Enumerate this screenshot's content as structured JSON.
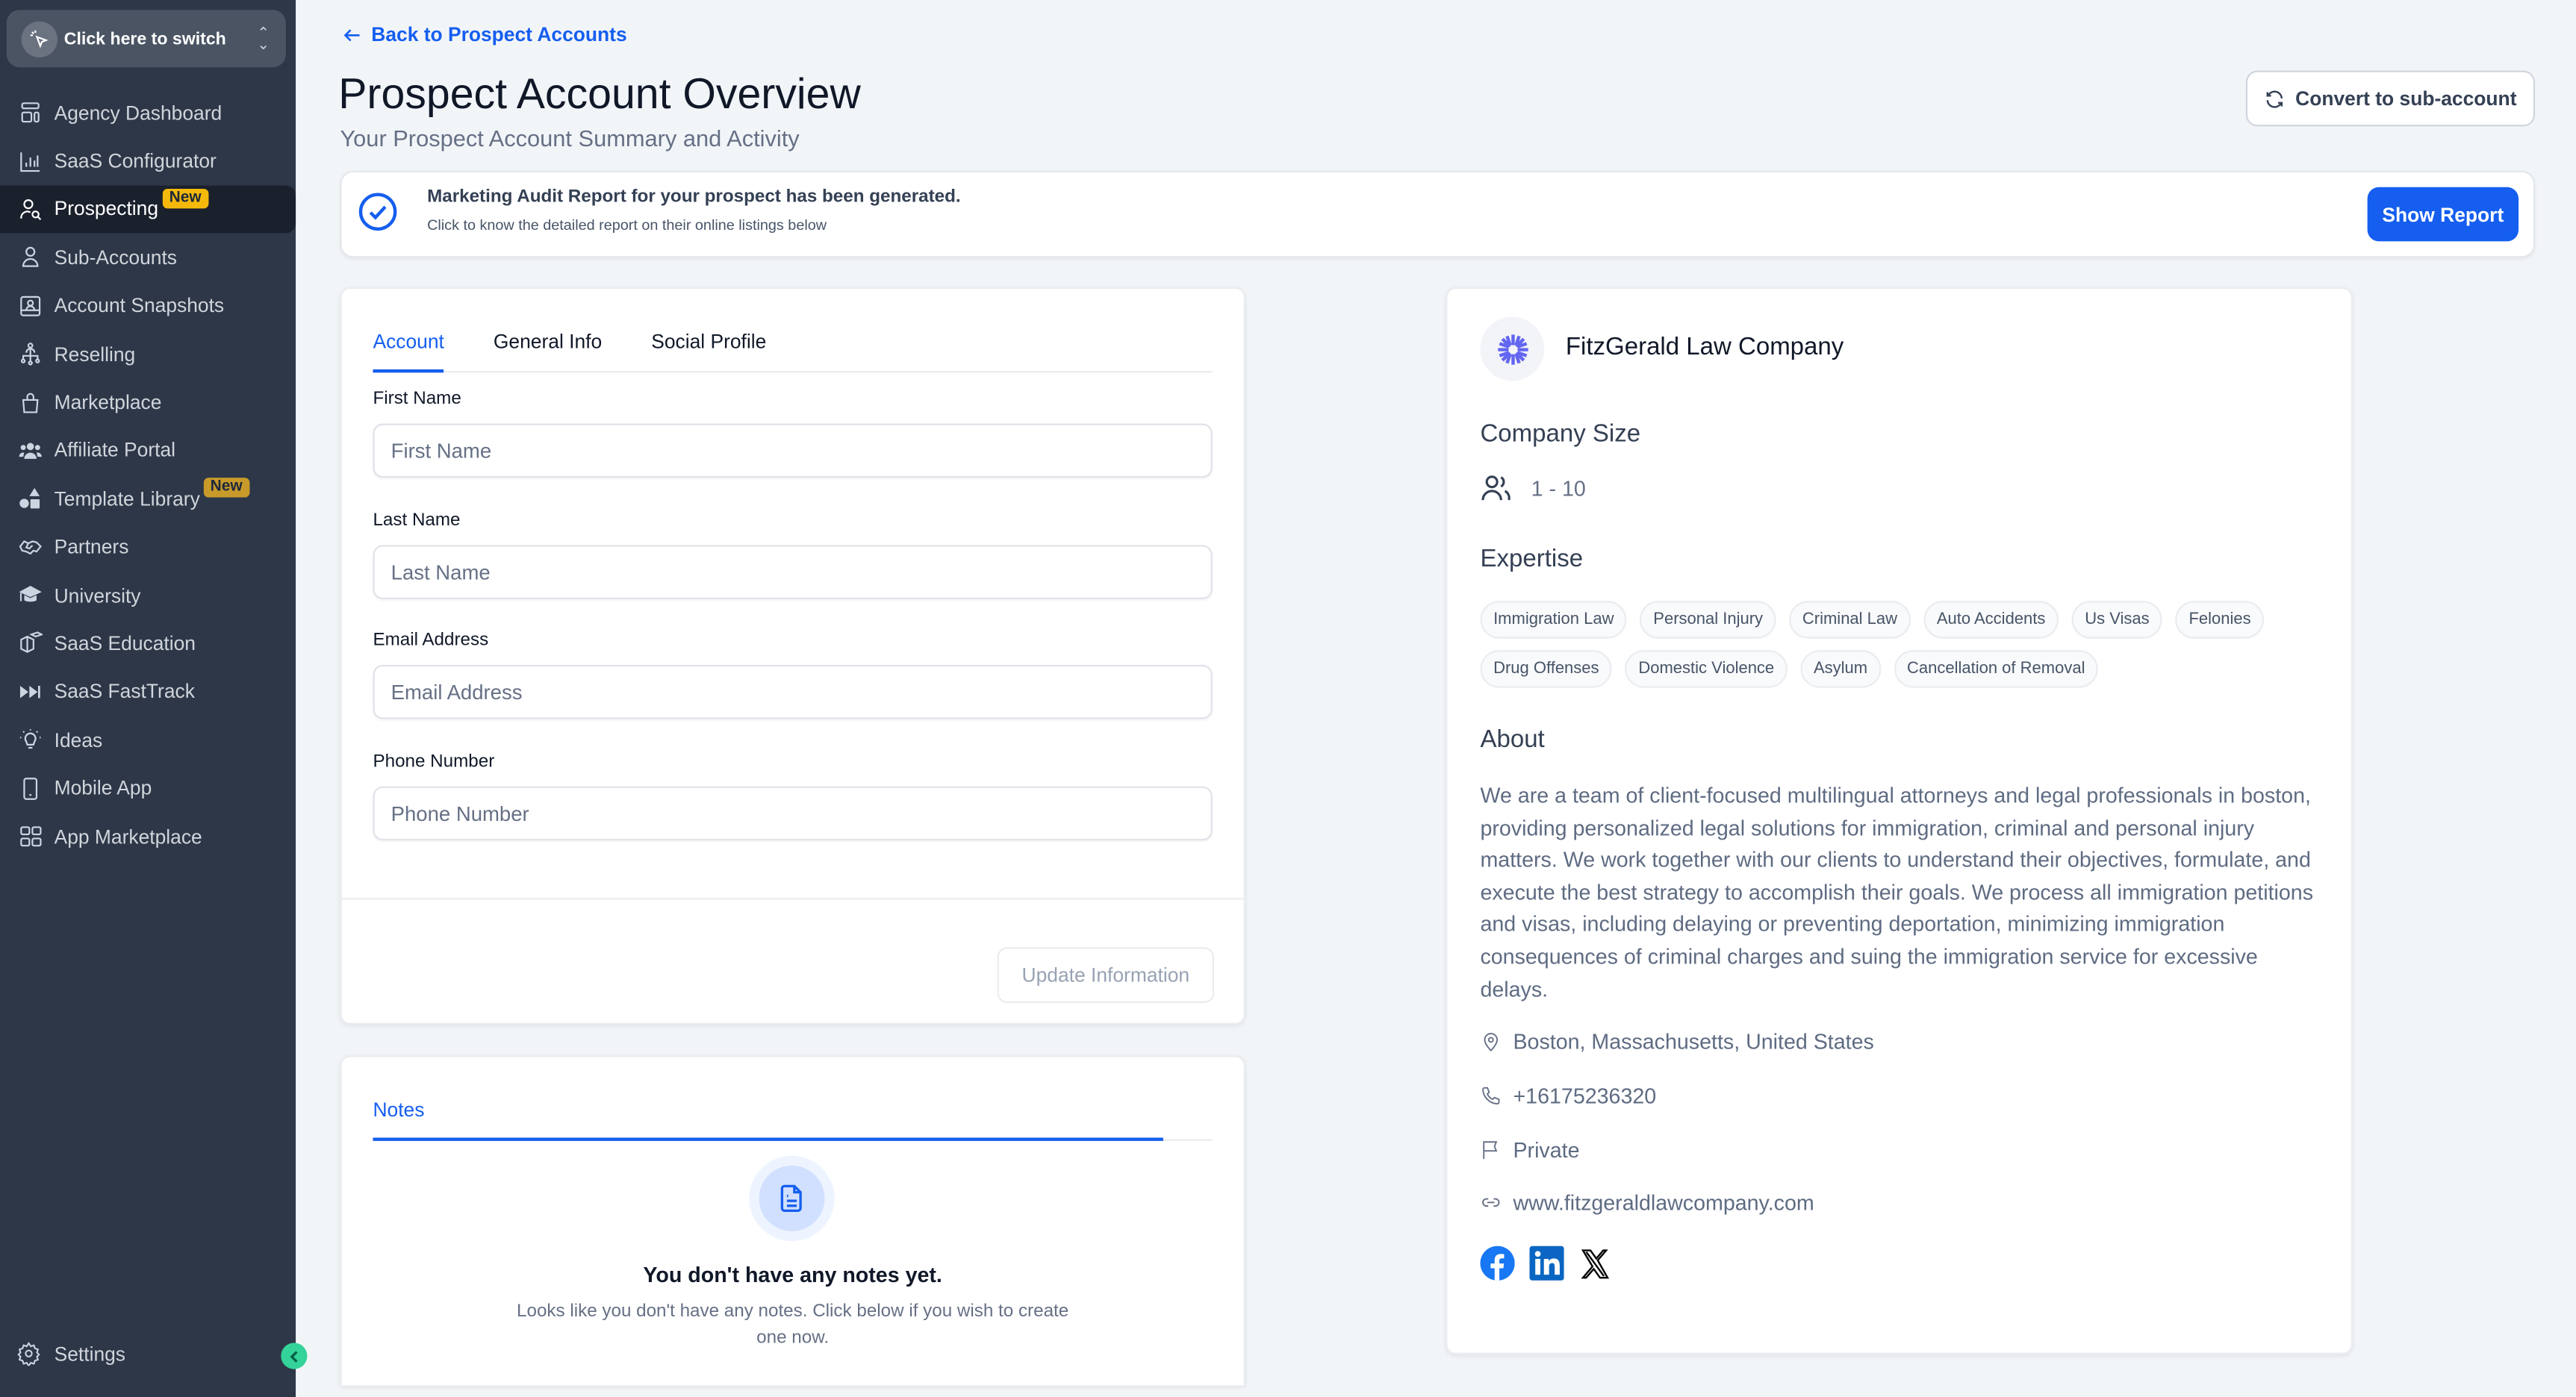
{
  "sidebar": {
    "switcher_label": "Click here to switch",
    "items": [
      {
        "label": "Agency Dashboard",
        "icon": "dashboard-icon"
      },
      {
        "label": "SaaS Configurator",
        "icon": "bar-chart-icon"
      },
      {
        "label": "Prospecting",
        "icon": "user-search-icon",
        "badge": "New",
        "active": true
      },
      {
        "label": "Sub-Accounts",
        "icon": "user-icon"
      },
      {
        "label": "Account Snapshots",
        "icon": "snapshot-icon"
      },
      {
        "label": "Reselling",
        "icon": "reselling-icon"
      },
      {
        "label": "Marketplace",
        "icon": "shopping-bag-icon"
      },
      {
        "label": "Affiliate Portal",
        "icon": "users-icon"
      },
      {
        "label": "Template Library",
        "icon": "shapes-icon",
        "badge": "New"
      },
      {
        "label": "Partners",
        "icon": "handshake-icon"
      },
      {
        "label": "University",
        "icon": "graduation-cap-icon"
      },
      {
        "label": "SaaS Education",
        "icon": "education-box-icon"
      },
      {
        "label": "SaaS FastTrack",
        "icon": "fast-forward-icon"
      },
      {
        "label": "Ideas",
        "icon": "lightbulb-icon"
      },
      {
        "label": "Mobile App",
        "icon": "mobile-icon"
      },
      {
        "label": "App Marketplace",
        "icon": "grid-icon"
      }
    ],
    "settings_label": "Settings"
  },
  "header": {
    "back_link": "Back to Prospect Accounts",
    "title": "Prospect Account Overview",
    "subtitle": "Your Prospect Account Summary and Activity",
    "convert_button": "Convert to sub-account"
  },
  "banner": {
    "title": "Marketing Audit Report for your prospect has been generated.",
    "description": "Click to know the detailed report on their online listings below",
    "button": "Show Report"
  },
  "form": {
    "tabs": [
      "Account",
      "General Info",
      "Social Profile"
    ],
    "active_tab": "Account",
    "fields": [
      {
        "label": "First Name",
        "placeholder": "First Name",
        "value": ""
      },
      {
        "label": "Last Name",
        "placeholder": "Last Name",
        "value": ""
      },
      {
        "label": "Email Address",
        "placeholder": "Email Address",
        "value": ""
      },
      {
        "label": "Phone Number",
        "placeholder": "Phone Number",
        "value": ""
      }
    ],
    "update_button": "Update Information"
  },
  "notes": {
    "tab": "Notes",
    "empty_title": "You don't have any notes yet.",
    "empty_description": "Looks like you don't have any notes. Click below if you wish to create one now."
  },
  "company": {
    "name": "FitzGerald Law Company",
    "size_heading": "Company Size",
    "size": "1 - 10",
    "expertise_heading": "Expertise",
    "expertise": [
      "Immigration Law",
      "Personal Injury",
      "Criminal Law",
      "Auto Accidents",
      "Us Visas",
      "Felonies",
      "Drug Offenses",
      "Domestic Violence",
      "Asylum",
      "Cancellation of Removal"
    ],
    "about_heading": "About",
    "about": "We are a team of client-focused multilingual attorneys and legal professionals in boston, providing personalized legal solutions for immigration, criminal and personal injury matters. We work together with our clients to understand their objectives, formulate, and execute the best strategy to accomplish their goals. We process all immigration petitions and visas, including delaying or preventing deportation, minimizing immigration consequences of criminal charges and suing the immigration service for excessive delays.",
    "location": "Boston, Massachusetts, United States",
    "phone": "+16175236320",
    "ownership": "Private",
    "website": "www.fitzgeraldlawcompany.com",
    "socials": [
      "facebook",
      "linkedin",
      "x"
    ]
  },
  "colors": {
    "accent": "#155eef",
    "sidebar_bg": "#2d3748",
    "badge": "#f5b90b",
    "collapse": "#34d399",
    "logo": "#6366f1"
  }
}
